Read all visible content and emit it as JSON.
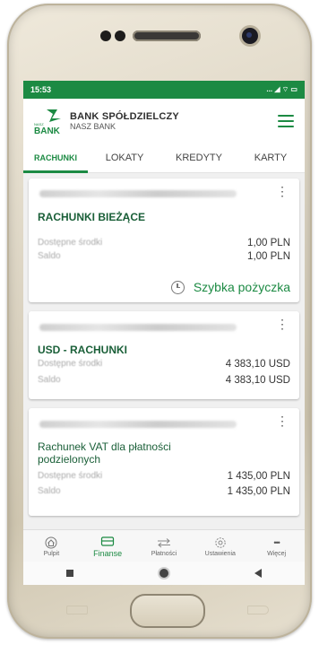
{
  "status": {
    "time": "15:53",
    "icons": "... ◢ ⌔ ▭"
  },
  "header": {
    "bank_line1": "BANK SPÓŁDZIELCZY",
    "bank_line2": "NASZ BANK",
    "logo_small": "NASZ",
    "logo_main": "BANK"
  },
  "tabs": [
    {
      "label": "RACHUNKI",
      "active": true
    },
    {
      "label": "LOKATY",
      "active": false
    },
    {
      "label": "KREDYTY",
      "active": false
    },
    {
      "label": "KARTY",
      "active": false
    }
  ],
  "accounts": [
    {
      "title": "RACHUNKI BIEŻĄCE",
      "label1": "Dostępne środki",
      "value1": "1,00 PLN",
      "label2": "Saldo",
      "value2": "1,00 PLN",
      "quick_link": "Szybka pożyczka"
    },
    {
      "title": "USD - RACHUNKI",
      "label1": "Dostępne środki",
      "value1": "4 383,10 USD",
      "label2": "Saldo",
      "value2": "4 383,10 USD"
    },
    {
      "title_line1": "Rachunek VAT dla płatności",
      "title_line2": "podzielonych",
      "label1": "Dostępne środki",
      "value1": "1 435,00 PLN",
      "label2": "Saldo",
      "value2": "1 435,00 PLN"
    }
  ],
  "bottom_nav": [
    {
      "label": "Pulpit",
      "icon": "home-icon"
    },
    {
      "label": "Finanse",
      "icon": "wallet-icon",
      "active": true
    },
    {
      "label": "Płatności",
      "icon": "transfer-arrows-icon"
    },
    {
      "label": "Ustawienia",
      "icon": "gear-icon"
    },
    {
      "label": "Więcej",
      "icon": "more-dots-icon",
      "glyph": "•••"
    }
  ],
  "colors": {
    "brand_green": "#1c8a43",
    "title_green": "#1a5f38"
  }
}
